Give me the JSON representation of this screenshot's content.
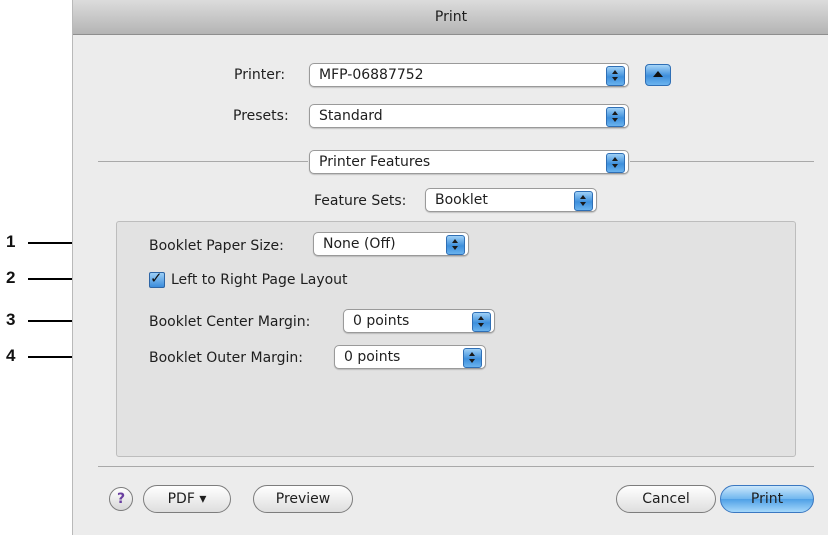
{
  "window": {
    "title": "Print"
  },
  "printer": {
    "label": "Printer:",
    "value": "MFP-06887752"
  },
  "presets": {
    "label": "Presets:",
    "value": "Standard"
  },
  "pane_select": {
    "value": "Printer Features"
  },
  "feature_sets": {
    "label": "Feature Sets:",
    "value": "Booklet"
  },
  "options": {
    "paper_size": {
      "label": "Booklet Paper Size:",
      "value": "None (Off)"
    },
    "left_to_right": {
      "label": "Left to Right Page Layout",
      "checked": true
    },
    "center_margin": {
      "label": "Booklet Center Margin:",
      "value": "0 points"
    },
    "outer_margin": {
      "label": "Booklet Outer Margin:",
      "value": "0 points"
    }
  },
  "callouts": [
    "1",
    "2",
    "3",
    "4"
  ],
  "buttons": {
    "help": "?",
    "pdf": "PDF ▾",
    "preview": "Preview",
    "cancel": "Cancel",
    "print": "Print"
  },
  "icons": {
    "disclosure": "disclosure-triangle-icon",
    "popup_arrows": "updown-arrows-icon",
    "checkmark": "checkmark-icon"
  },
  "colors": {
    "accent": "#3e8fdc",
    "window_bg": "#ececec"
  }
}
